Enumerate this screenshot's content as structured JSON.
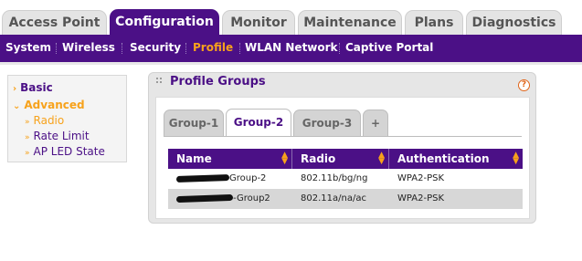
{
  "top_tabs": [
    {
      "label": "Access Point",
      "active": false
    },
    {
      "label": "Configuration",
      "active": true
    },
    {
      "label": "Monitor",
      "active": false
    },
    {
      "label": "Maintenance",
      "active": false
    },
    {
      "label": "Plans",
      "active": false
    },
    {
      "label": "Diagnostics",
      "active": false
    }
  ],
  "sub_menu": [
    {
      "label": "System",
      "active": false
    },
    {
      "label": "Wireless",
      "active": false
    },
    {
      "label": "Security",
      "active": false
    },
    {
      "label": "Profile",
      "active": true
    },
    {
      "label": "WLAN Network",
      "active": false
    },
    {
      "label": "Captive Portal",
      "active": false
    }
  ],
  "left_nav": {
    "basic": "Basic",
    "advanced": "Advanced",
    "items": [
      "Radio",
      "Rate Limit",
      "AP LED State"
    ]
  },
  "panel": {
    "title": "Profile Groups",
    "help_glyph": "?",
    "group_tabs": [
      "Group-1",
      "Group-2",
      "Group-3",
      "+"
    ],
    "active_group": "Group-2"
  },
  "table": {
    "columns": [
      "Name",
      "Radio",
      "Authentication"
    ],
    "rows": [
      {
        "name_suffix": "Group-2",
        "radio": "802.11b/bg/ng",
        "auth": "WPA2-PSK"
      },
      {
        "name_suffix": "-Group2",
        "radio": "802.11a/na/ac",
        "auth": "WPA2-PSK"
      }
    ]
  },
  "colors": {
    "brand_purple": "#4b1086",
    "accent_orange": "#f7a21b"
  }
}
